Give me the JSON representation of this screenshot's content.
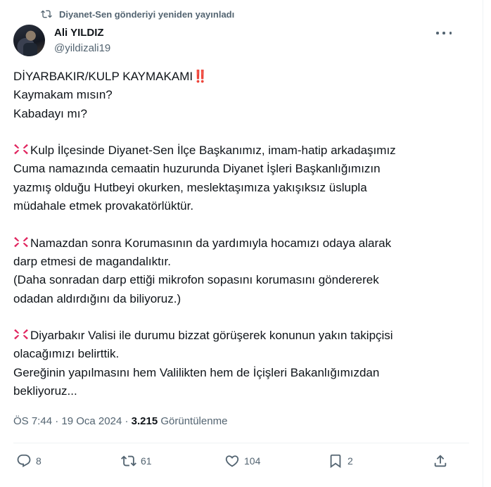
{
  "repost_banner": {
    "icon": "repost-icon",
    "text": "Diyanet-Sen gönderiyi yeniden yayınladı"
  },
  "author": {
    "name": "Ali YILDIZ",
    "handle": "@yildizali19"
  },
  "tweet": {
    "lines": [
      {
        "text": "DİYARBAKIR/KULP KAYMAKAMI",
        "suffix": "‼️"
      },
      {
        "text": "Kaymakam mısın?"
      },
      {
        "text": "Kabadayı mı?"
      },
      {
        "text": ""
      },
      {
        "prefix": "💢",
        "text": "Kulp İlçesinde Diyanet-Sen İlçe Başkanımız, imam-hatip arkadaşımız"
      },
      {
        "text": "Cuma namazında cemaatin huzurunda Diyanet İşleri Başkanlığımızın"
      },
      {
        "text": "yazmış olduğu Hutbeyi okurken, meslektaşımıza yakışıksız üslupla"
      },
      {
        "text": "müdahale etmek provakatörlüktür."
      },
      {
        "text": ""
      },
      {
        "prefix": "💢",
        "text": "Namazdan sonra Korumasının da yardımıyla hocamızı odaya alarak"
      },
      {
        "text": "darp etmesi de magandalıktır."
      },
      {
        "text": "(Daha sonradan darp ettiği mikrofon sopasını korumasını göndererek"
      },
      {
        "text": "odadan aldırdığını da biliyoruz.)"
      },
      {
        "text": ""
      },
      {
        "prefix": "💢",
        "text": "Diyarbakır Valisi ile durumu bizzat görüşerek konunun yakın takipçisi"
      },
      {
        "text": "olacağımızı belirttik."
      },
      {
        "text": "Gereğinin yapılmasını hem Valilikten hem de İçişleri Bakanlığımızdan"
      },
      {
        "text": "bekliyoruz..."
      }
    ]
  },
  "meta": {
    "time": "ÖS 7:44",
    "dot": "·",
    "date": "19 Oca 2024",
    "views": "3.215",
    "views_label": "Görüntülenme"
  },
  "actions": {
    "reply": {
      "icon": "reply-icon",
      "count": "8"
    },
    "repost": {
      "icon": "repost-icon",
      "count": "61"
    },
    "like": {
      "icon": "like-icon",
      "count": "104"
    },
    "bookmark": {
      "icon": "bookmark-icon",
      "count": "2"
    },
    "share": {
      "icon": "share-icon"
    }
  },
  "colors": {
    "text": "#0f1419",
    "muted": "#536471",
    "border": "#eff3f4",
    "accent_red": "#e0245e"
  }
}
